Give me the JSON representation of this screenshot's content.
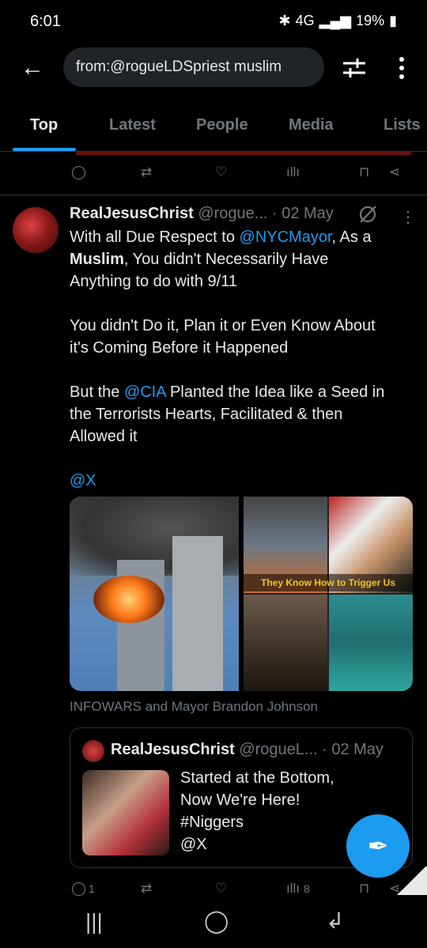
{
  "status_bar": {
    "time": "6:01",
    "network": "4G",
    "battery": "19%"
  },
  "search": {
    "query": "from:@rogueLDSpriest muslim"
  },
  "tabs": [
    "Top",
    "Latest",
    "People",
    "Media",
    "Lists"
  ],
  "active_tab": "Top",
  "tweet": {
    "name": "RealJesusChrist",
    "handle": "@rogue...",
    "date": "· 02 May",
    "line1a": "With all Due Respect to ",
    "mention_mayor": "@NYCMayor",
    "line1b": ", As a",
    "muslim_bold": "Muslim",
    "line2": ", You didn't Necessarily Have",
    "line3": "Anything to do with 9/11",
    "para2_1": "You didn't Do it, Plan it or Even Know About",
    "para2_2": "it's Coming Before it Happened",
    "para3_a": "But the ",
    "mention_cia": "@CIA",
    "para3_b": " Planted the Idea like a Seed in",
    "para3_2": "the Terrorists Hearts, Facilitated & then",
    "para3_3": "Allowed it",
    "mention_x": "@X",
    "image_overlay_text": "They Know How to Trigger Us",
    "media_caption": "INFOWARS and Mayor Brandon Johnson"
  },
  "quote": {
    "name": "RealJesusChrist",
    "handle": "@rogueL...",
    "date": "· 02 May",
    "line1": "Started at the Bottom,",
    "line2": "Now We're Here!",
    "line3": "#Niggers",
    "line4": "@X"
  },
  "actions_bottom": {
    "reply_count": "1",
    "views_count": "8"
  },
  "colors": {
    "accent": "#1d9bf0",
    "background": "#000000",
    "muted": "#71767b"
  }
}
